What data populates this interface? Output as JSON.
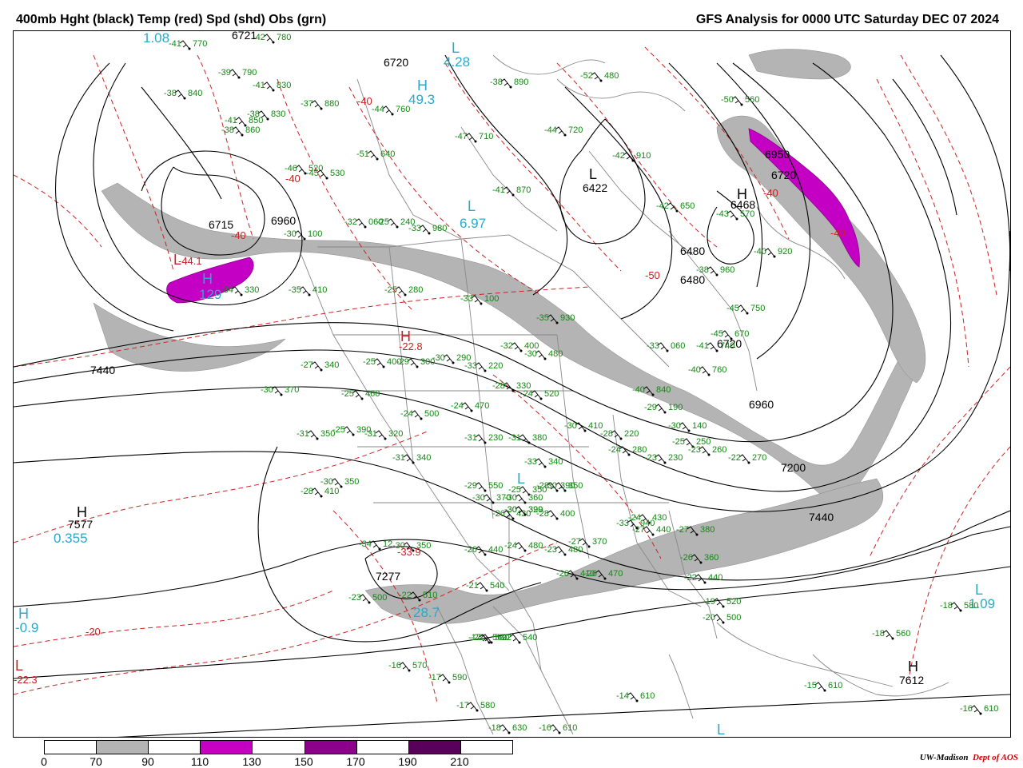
{
  "header": {
    "left_title": "400mb Hght (black) Temp (red) Spd (shd) Obs (grn)",
    "right_title": "GFS Analysis for 0000 UTC Saturday  DEC 07 2024"
  },
  "colors": {
    "height_contour": "#000000",
    "temp_contour": "#cc2222",
    "obs": "#118811",
    "extrema_value": "#2aa9c9",
    "speed_70_90": "#b4b4b4",
    "speed_110_130": "#c300c3",
    "speed_150_170": "#8c008c",
    "speed_190_210": "#5a005a",
    "borders": "#888888"
  },
  "legend": {
    "ticks": [
      "0",
      "70",
      "90",
      "110",
      "130",
      "150",
      "170",
      "190",
      "210"
    ],
    "segment_colors": [
      "#ffffff",
      "#b4b4b4",
      "#ffffff",
      "#c300c3",
      "#ffffff",
      "#8c008c",
      "#ffffff",
      "#5a005a",
      "#ffffff"
    ]
  },
  "credit": {
    "org": "UW-Madison",
    "dept": "Dept of AOS"
  },
  "map": {
    "height_labels": [
      "6721",
      "6720",
      "6715",
      "6960",
      "6422",
      "6468",
      "6480",
      "6480",
      "6720",
      "6960",
      "6950",
      "6720",
      "7440",
      "7577",
      "7277",
      "7200",
      "7440",
      "7612"
    ],
    "extrema_symbols": [
      "L",
      "L",
      "H",
      "L",
      "H",
      "L",
      "H",
      "L",
      "L",
      "H",
      "L",
      "H",
      "H",
      "H",
      "L",
      "L"
    ],
    "extrema_values": [
      "1.08",
      "4.28",
      "49.3",
      "6.97",
      "129",
      "0.355",
      "-0.9",
      "1.09",
      "28.7"
    ],
    "temp_labels": [
      "-40",
      "-40",
      "-40",
      "-44.1",
      "-40",
      "-40",
      "-33.9",
      "-22.8",
      "-20",
      "-22.3",
      "-50"
    ],
    "obs_values": [
      "-41",
      "770",
      "-42",
      "780",
      "-39",
      "790",
      "-41",
      "830",
      "-38",
      "840",
      "-38",
      "830",
      "-41",
      "850",
      "-38",
      "860",
      "-37",
      "880",
      "-44",
      "760",
      "-51",
      "640",
      "-47",
      "710",
      "-38",
      "890",
      "-52",
      "480",
      "-50",
      "560",
      "-44",
      "720",
      "-42",
      "910",
      "-41",
      "870",
      "-46",
      "520",
      "-45",
      "530",
      "-42",
      "650",
      "-43",
      "570",
      "-40",
      "920",
      "-38",
      "960",
      "-33",
      "980",
      "-32",
      "060",
      "-25",
      "240",
      "-30",
      "100",
      "-25",
      "280",
      "-33",
      "100",
      "-35",
      "410",
      "-30",
      "480",
      "-25",
      "400",
      "-27",
      "340",
      "-29",
      "300",
      "-30",
      "290",
      "-33",
      "220",
      "-28",
      "330",
      "-24",
      "520",
      "-24",
      "470",
      "-30",
      "370",
      "-25",
      "460",
      "-24",
      "500",
      "-25",
      "390",
      "-31",
      "350",
      "-31",
      "320",
      "-31",
      "230",
      "-31",
      "380",
      "-30",
      "410",
      "-31",
      "340",
      "-30",
      "350",
      "-29",
      "550",
      "-25",
      "350",
      "-33",
      "340",
      "-30",
      "370",
      "-30",
      "360",
      "-28",
      "390",
      "-30",
      "399",
      "-30",
      "350",
      "-28",
      "400",
      "-26",
      "430",
      "-26",
      "440",
      "-24",
      "480",
      "-23",
      "480",
      "-27",
      "370",
      "-26",
      "410",
      "-26",
      "470",
      "-23",
      "500",
      "-22",
      "510",
      "-21",
      "540",
      "-22",
      "530",
      "-22",
      "540",
      "-17",
      "560",
      "-16",
      "570",
      "-17",
      "590",
      "-17",
      "580",
      "-18",
      "630",
      "-16",
      "610",
      "-14",
      "610",
      "-15",
      "610",
      "-16",
      "610",
      "-18",
      "580",
      "-18",
      "560",
      "-20",
      "500",
      "-19",
      "520",
      "-22",
      "440",
      "-26",
      "360",
      "-27",
      "380",
      "-27",
      "440",
      "-24",
      "430",
      "-33",
      "940",
      "-35",
      "930",
      "-40",
      "840",
      "-40",
      "760",
      "-41",
      "740",
      "-45",
      "670",
      "-45",
      "750",
      "-33",
      "060",
      "-29",
      "190",
      "-28",
      "220",
      "-25",
      "250",
      "-23",
      "260",
      "-22",
      "270",
      "-24",
      "280",
      "-23",
      "230",
      "-30",
      "140",
      "-32",
      "400",
      "-34",
      "330",
      "-28",
      "410",
      "-30",
      "320",
      "-34",
      "12",
      "-30",
      "350"
    ]
  }
}
